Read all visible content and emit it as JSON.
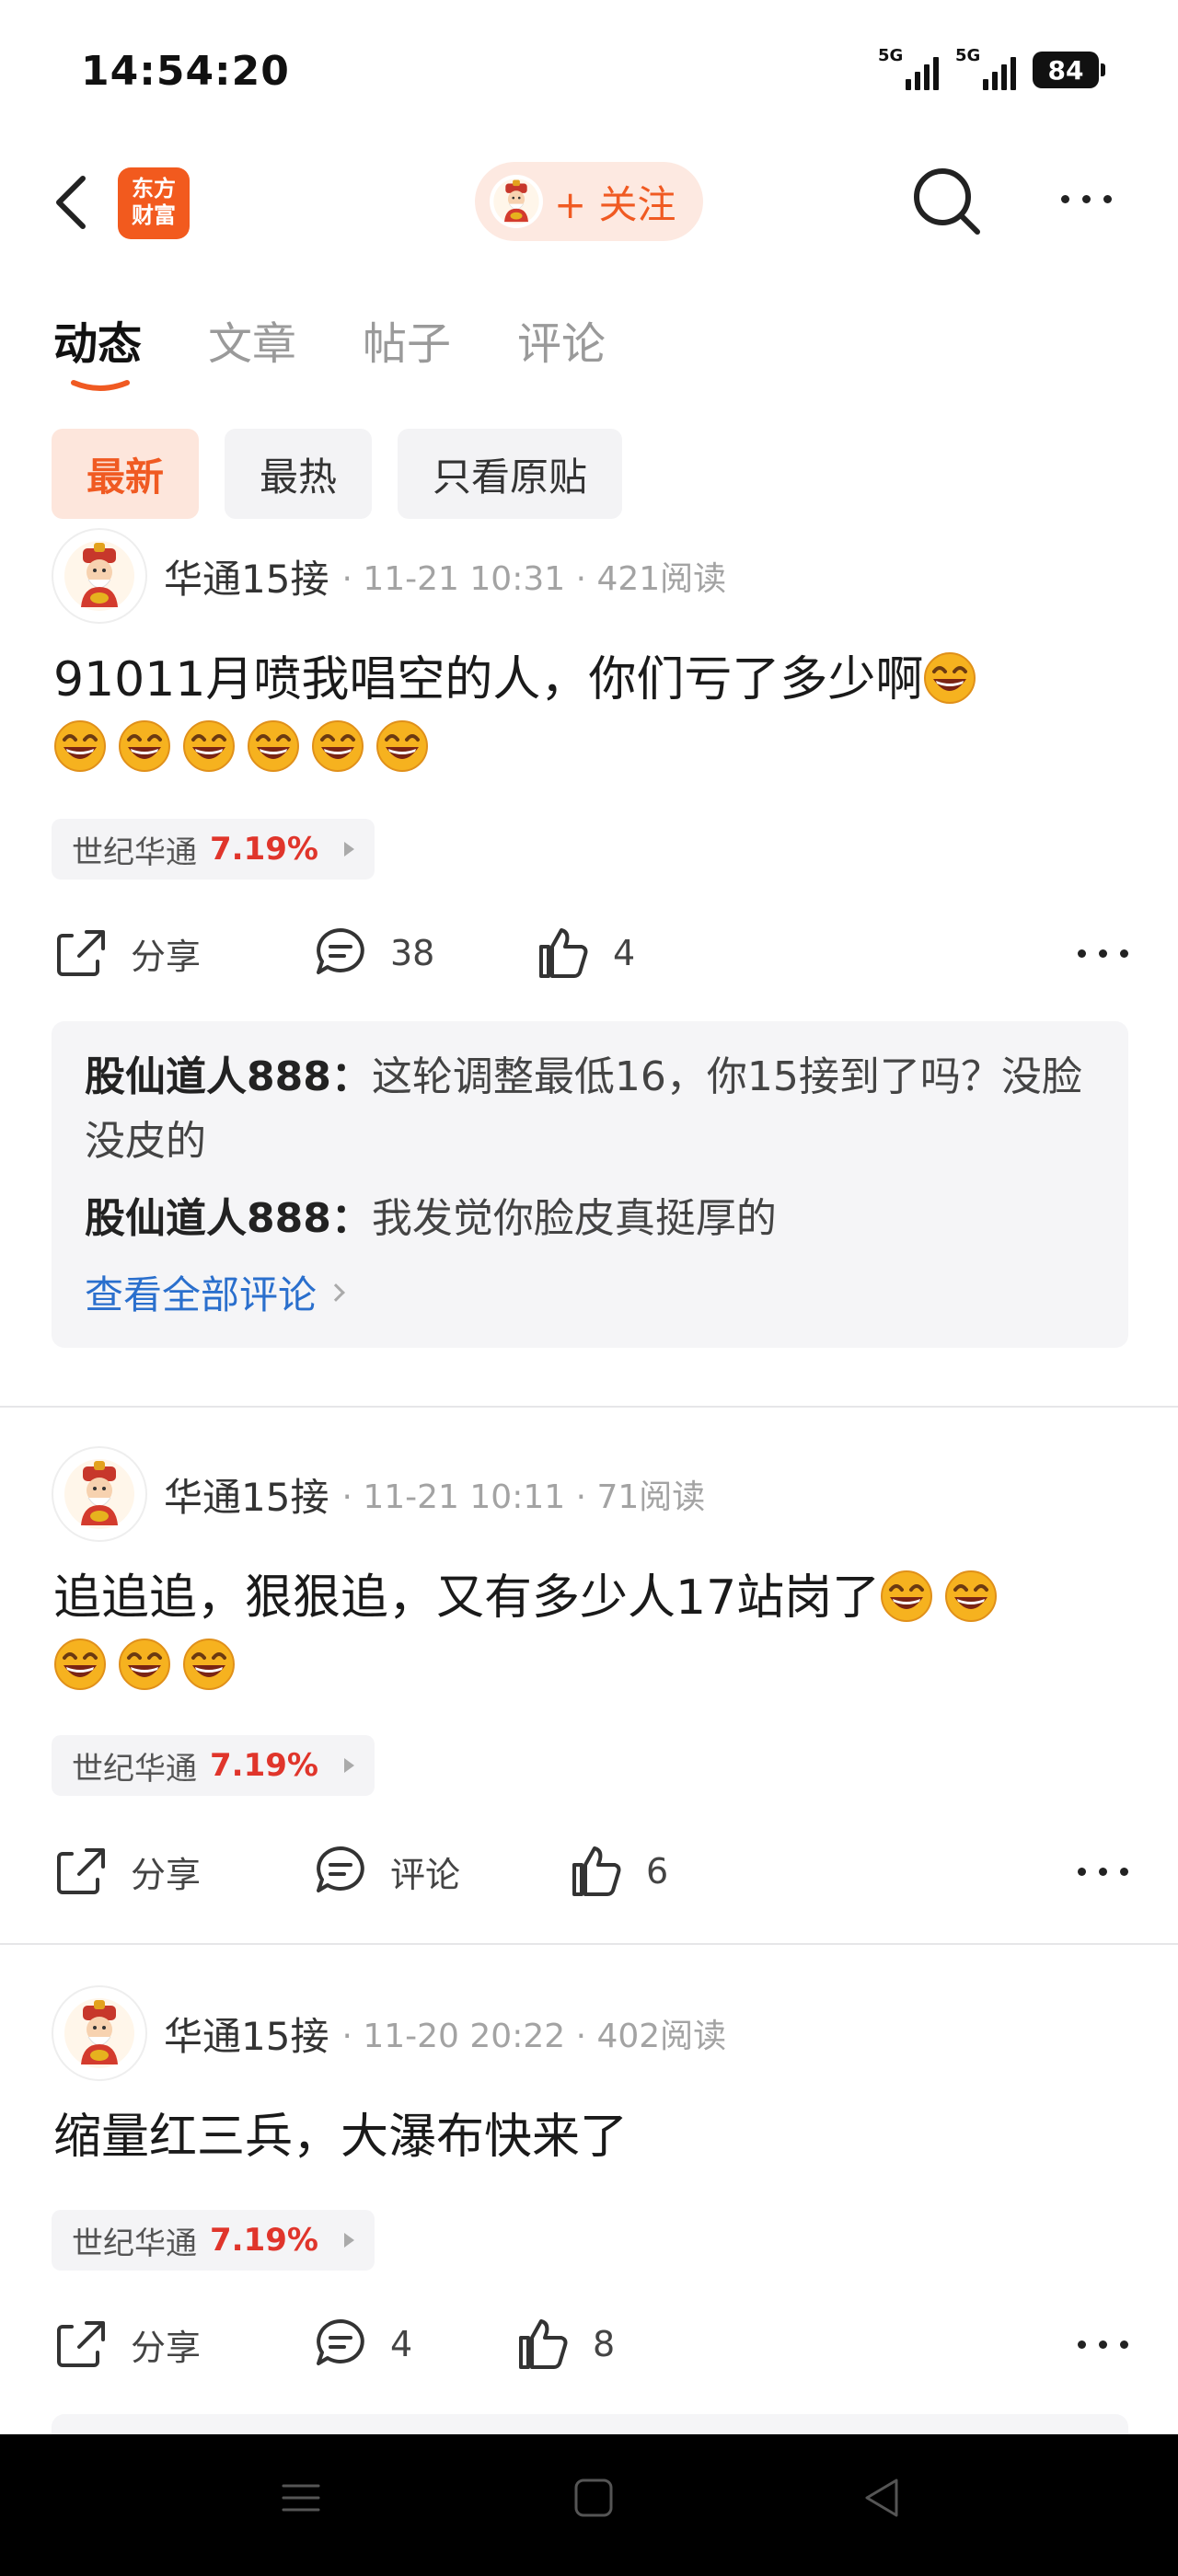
{
  "status": {
    "time": "14:54:20",
    "signal1": "5G",
    "signal2": "5G",
    "battery": "84"
  },
  "header": {
    "logo_text": "东方\n财富",
    "follow_label": "+ 关注"
  },
  "tabs": [
    {
      "label": "动态"
    },
    {
      "label": "文章"
    },
    {
      "label": "帖子"
    },
    {
      "label": "评论"
    }
  ],
  "filters": [
    {
      "label": "最新"
    },
    {
      "label": "最热"
    },
    {
      "label": "只看原贴"
    }
  ],
  "colors": {
    "accent": "#f05a22",
    "up": "#e0352b",
    "link": "#2a6fcd"
  },
  "posts": [
    {
      "author": "华通15接",
      "meta": "· 11-21 10:31 · 421阅读",
      "text": "91011月喷我唱空的人，你们亏了多少啊",
      "stock_name": "世纪华通",
      "stock_pct": "7.19%",
      "share_label": "分享",
      "comment_count": "38",
      "like_count": "4",
      "comments": [
        {
          "user": "股仙道人888：",
          "text": "这轮调整最低16，你15接到了吗？没脸没皮的"
        },
        {
          "user": "股仙道人888：",
          "text": "我发觉你脸皮真挺厚的"
        }
      ],
      "view_all": "查看全部评论"
    },
    {
      "author": "华通15接",
      "meta": "· 11-21 10:11 · 71阅读",
      "text": "追追追，狠狠追，又有多少人17站岗了",
      "stock_name": "世纪华通",
      "stock_pct": "7.19%",
      "share_label": "分享",
      "comment_count": "评论",
      "like_count": "6"
    },
    {
      "author": "华通15接",
      "meta": "· 11-20 20:22 · 402阅读",
      "text": "缩量红三兵，大瀑布快来了",
      "stock_name": "世纪华通",
      "stock_pct": "7.19%",
      "share_label": "分享",
      "comment_count": "4",
      "like_count": "8"
    }
  ]
}
